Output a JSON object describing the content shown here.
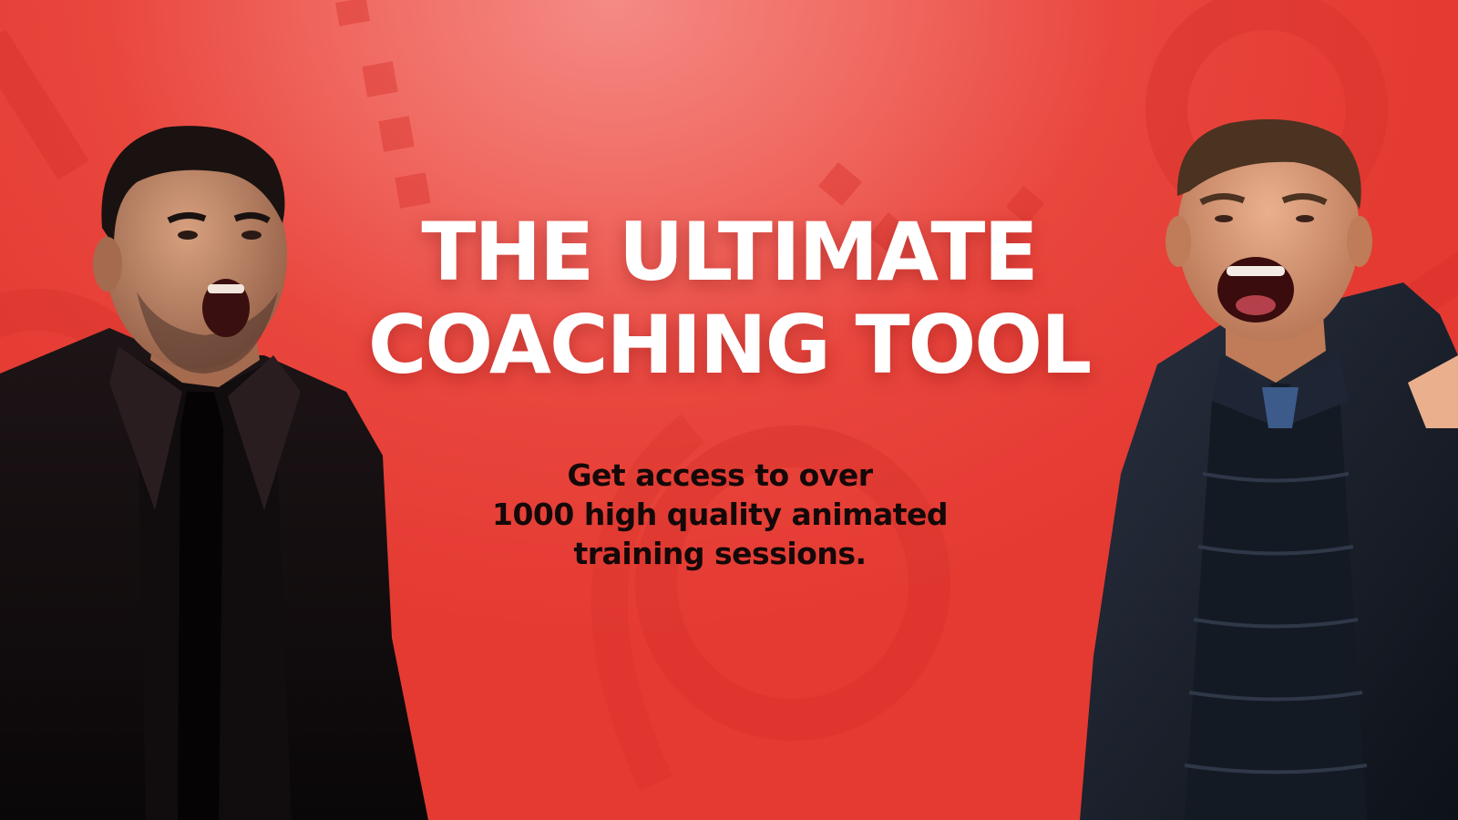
{
  "banner": {
    "headline_line1": "THE ULTIMATE",
    "headline_line2": "COACHING TOOL",
    "sub_line1": "Get access to over",
    "sub_line2": "1000 high quality animated",
    "sub_line3": "training sessions."
  },
  "images": {
    "left_coach": "coach-photo-left",
    "right_coach": "coach-photo-right"
  },
  "colors": {
    "background": "#e9463d",
    "headline": "#ffffff",
    "subline": "#140808"
  }
}
